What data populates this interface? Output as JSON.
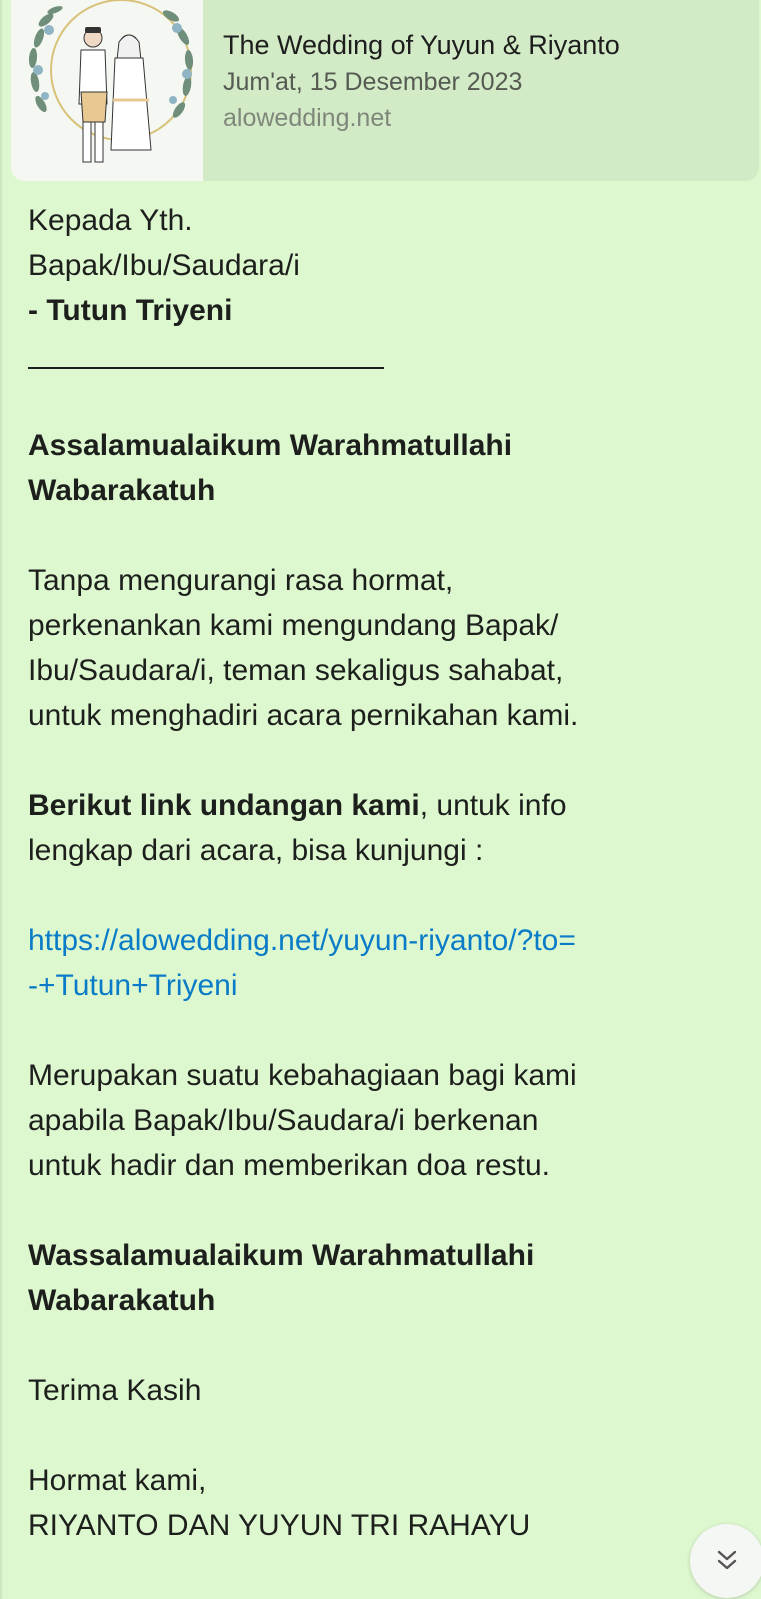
{
  "preview": {
    "title": "The Wedding of Yuyun & Riyanto",
    "date": "Jum'at, 15 Desember 2023",
    "domain": "alowedding.net",
    "thumbnail_icon": "couple-illustration-icon"
  },
  "message": {
    "greeting_line1": "Kepada Yth.",
    "greeting_line2": "Bapak/Ibu/Saudara/i",
    "recipient": "- Tutun Triyeni",
    "salam_open_1": "Assalamualaikum Warahmatullahi",
    "salam_open_2": "Wabarakatuh",
    "para1_l1": "Tanpa mengurangi rasa hormat,",
    "para1_l2": "perkenankan kami mengundang Bapak/",
    "para1_l3": "Ibu/Saudara/i, teman sekaligus sahabat,",
    "para1_l4": "untuk menghadiri acara pernikahan kami.",
    "para2_bold": "Berikut link undangan kami",
    "para2_rest": ", untuk info",
    "para2_l2": "lengkap dari acara, bisa kunjungi :",
    "link_l1": "https://alowedding.net/yuyun-riyanto/?to=",
    "link_l2": "-+Tutun+Triyeni",
    "para3_l1": "Merupakan suatu kebahagiaan bagi kami",
    "para3_l2": "apabila Bapak/Ibu/Saudara/i berkenan",
    "para3_l3": "untuk hadir dan memberikan doa restu.",
    "salam_close_1": "Wassalamualaikum Warahmatullahi",
    "salam_close_2": "Wabarakatuh",
    "thanks": "Terima Kasih",
    "closing": "Hormat kami,",
    "signature": "RIYANTO DAN YUYUN TRI RAHAYU"
  },
  "scroll_button": {
    "icon": "double-chevron-down-icon"
  },
  "colors": {
    "bubble_bg": "#ddf8cf",
    "preview_bg": "#d2ebc6",
    "link": "#0a7bc6",
    "text": "#1d1f1c"
  }
}
